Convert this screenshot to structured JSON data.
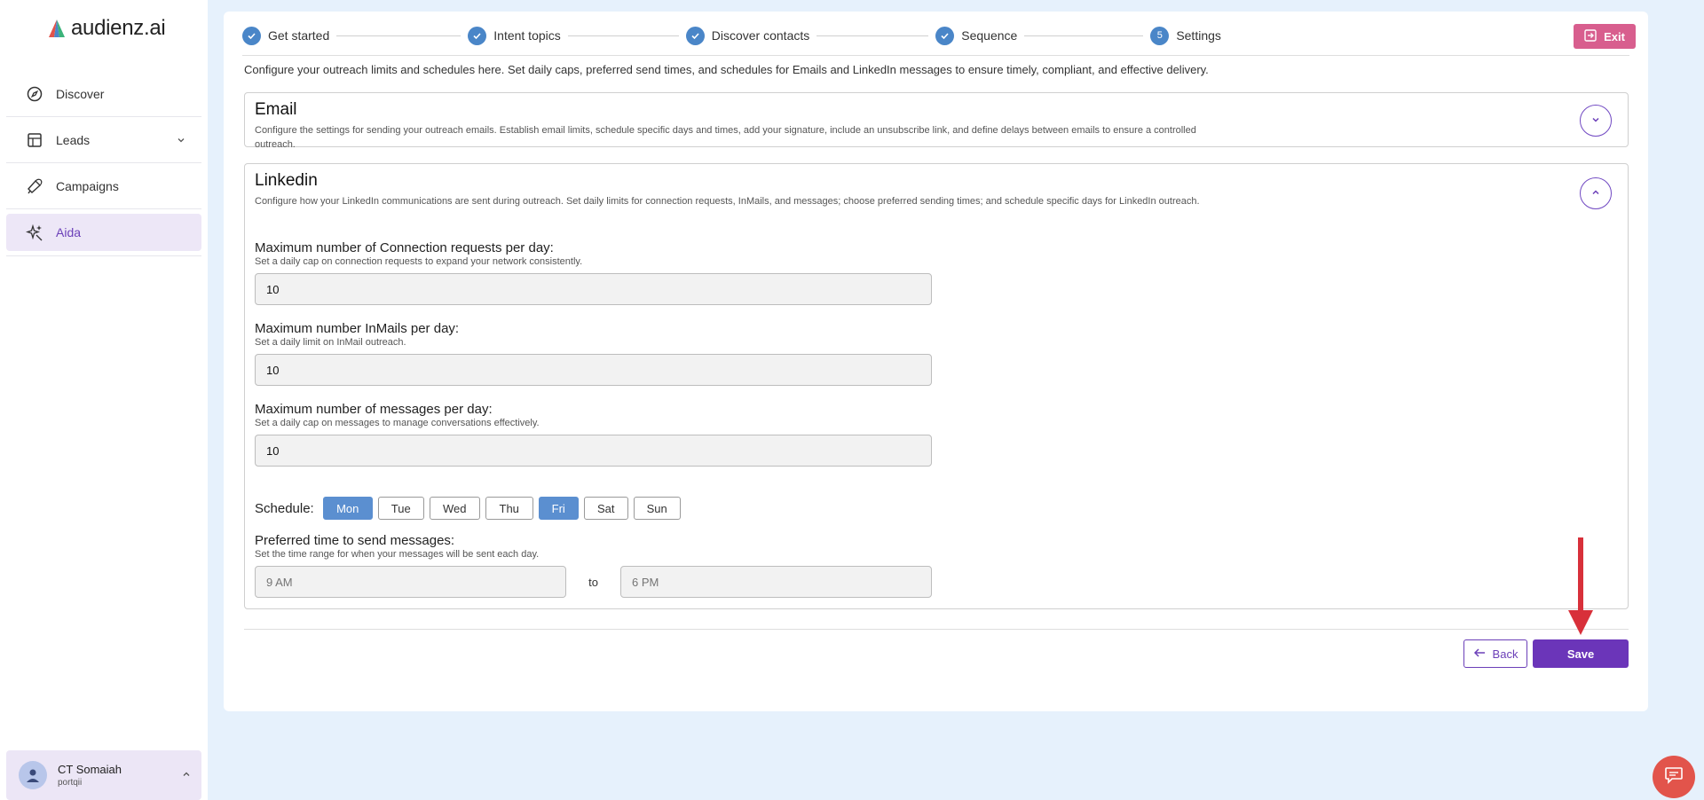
{
  "brand": {
    "name": "audienz.ai"
  },
  "sidebar": {
    "items": [
      {
        "label": "Discover",
        "icon": "compass-icon"
      },
      {
        "label": "Leads",
        "icon": "table-icon"
      },
      {
        "label": "Campaigns",
        "icon": "megaphone-icon"
      },
      {
        "label": "Aida",
        "icon": "sparkle-icon",
        "active": true
      }
    ],
    "user": {
      "name": "CT Somaiah",
      "org": "portqii"
    }
  },
  "stepper": {
    "steps": [
      {
        "label": "Get started",
        "state": "done"
      },
      {
        "label": "Intent topics",
        "state": "done"
      },
      {
        "label": "Discover contacts",
        "state": "done"
      },
      {
        "label": "Sequence",
        "state": "done"
      },
      {
        "label": "Settings",
        "state": "current",
        "number": "5"
      }
    ]
  },
  "header": {
    "exit_label": "Exit"
  },
  "intro": "Configure your outreach limits and schedules here. Set daily caps, preferred send times, and schedules for Emails and LinkedIn messages to ensure timely, compliant, and effective delivery.",
  "email": {
    "title": "Email",
    "description": "Configure the settings for sending your outreach emails. Establish email limits, schedule specific days and times, add your signature, include an unsubscribe link, and define delays between emails to ensure a controlled outreach."
  },
  "linkedin": {
    "title": "Linkedin",
    "description": "Configure how your LinkedIn communications are sent during outreach. Set daily limits for connection requests, InMails, and messages; choose preferred sending times; and schedule specific days for LinkedIn outreach.",
    "fields": [
      {
        "label": "Maximum number of Connection requests per day:",
        "help": "Set a daily cap on connection requests to expand your network consistently.",
        "value": "10"
      },
      {
        "label": "Maximum number InMails per day:",
        "help": "Set a daily limit on InMail outreach.",
        "value": "10"
      },
      {
        "label": "Maximum number of messages per day:",
        "help": "Set a daily cap on messages to manage conversations effectively.",
        "value": "10"
      }
    ],
    "schedule_label": "Schedule:",
    "days": [
      {
        "label": "Mon",
        "selected": true
      },
      {
        "label": "Tue",
        "selected": false
      },
      {
        "label": "Wed",
        "selected": false
      },
      {
        "label": "Thu",
        "selected": false
      },
      {
        "label": "Fri",
        "selected": true
      },
      {
        "label": "Sat",
        "selected": false
      },
      {
        "label": "Sun",
        "selected": false
      }
    ],
    "time": {
      "label": "Preferred time to send messages:",
      "help": "Set the time range for when your messages will be sent each day.",
      "from_placeholder": "9 AM",
      "separator": "to",
      "to_placeholder": "6 PM"
    }
  },
  "footer": {
    "back_label": "Back",
    "save_label": "Save"
  },
  "colors": {
    "accent": "#6b35b9",
    "step": "#4a86c8",
    "day_selected": "#5b8fd0",
    "exit": "#d85e8e",
    "chat": "#e2544b",
    "arrow": "#d8303a"
  }
}
